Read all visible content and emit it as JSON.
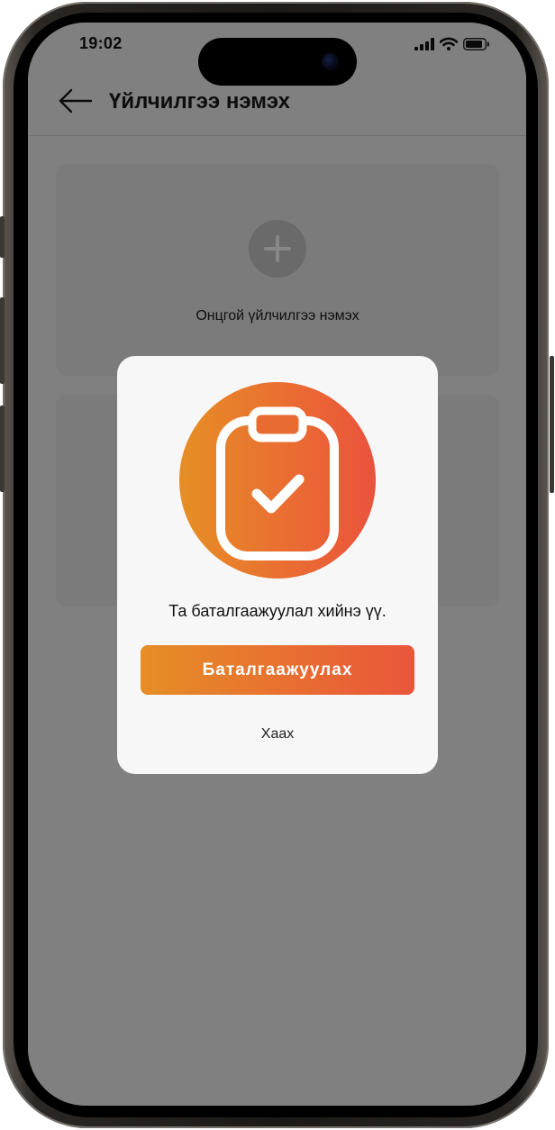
{
  "status_bar": {
    "time": "19:02",
    "icons": [
      "signal-icon",
      "wifi-icon",
      "battery-icon"
    ]
  },
  "header": {
    "back_icon": "arrow-left-icon",
    "title": "Үйлчилгээ нэмэх"
  },
  "cards": [
    {
      "icon": "plus-icon",
      "label": "Онцгой үйлчилгээ нэмэх"
    },
    {
      "icon": "",
      "label": ""
    }
  ],
  "modal": {
    "icon": "clipboard-check-icon",
    "message": "Та баталгаажуулал хийнэ үү.",
    "confirm_label": "Баталгаажуулах",
    "close_label": "Хаах"
  },
  "colors": {
    "accent_start": "#E68F25",
    "accent_end": "#E9533C",
    "overlay": "rgba(0,0,0,0.47)",
    "modal_background": "#F7F7F7"
  }
}
